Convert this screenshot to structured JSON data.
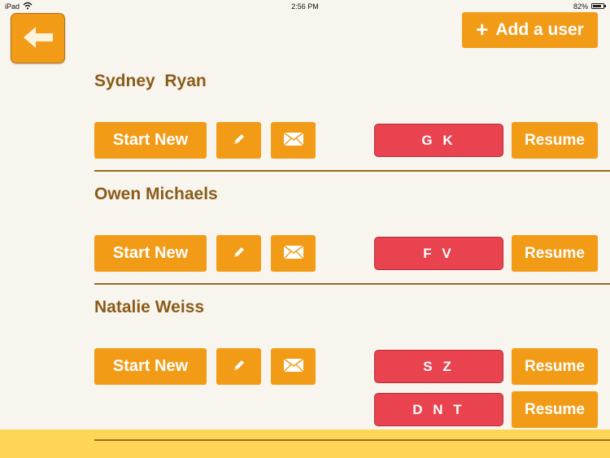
{
  "status_bar": {
    "carrier": "iPad",
    "time": "2:56 PM",
    "battery_percent": "82%",
    "battery_level": 0.82
  },
  "header": {
    "back_icon": "arrow-left-icon",
    "add_user_label": "Add a user",
    "add_user_icon": "+"
  },
  "colors": {
    "accent": "#f29b16",
    "session": "#e8434f",
    "name_text": "#8a5c19",
    "background": "#f8f5ef",
    "footer": "#fed557"
  },
  "users": [
    {
      "name": "Sydney  Ryan",
      "start_label": "Start New",
      "edit_icon": "pencil-icon",
      "mail_icon": "envelope-icon",
      "sessions": [
        {
          "label": "G K",
          "resume_label": "Resume"
        }
      ]
    },
    {
      "name": "Owen Michaels",
      "start_label": "Start New",
      "edit_icon": "pencil-icon",
      "mail_icon": "envelope-icon",
      "sessions": [
        {
          "label": "F V",
          "resume_label": "Resume"
        }
      ]
    },
    {
      "name": "Natalie Weiss",
      "start_label": "Start New",
      "edit_icon": "pencil-icon",
      "mail_icon": "envelope-icon",
      "sessions": [
        {
          "label": "S Z",
          "resume_label": "Resume"
        },
        {
          "label": "D N T",
          "resume_label": "Resume"
        }
      ]
    }
  ]
}
